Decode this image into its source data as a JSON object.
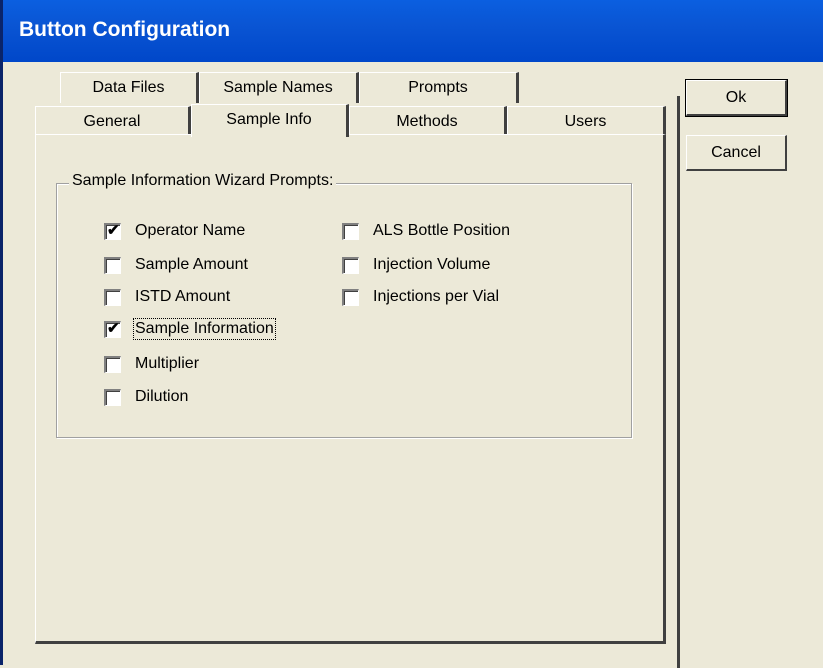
{
  "window": {
    "title": "Button Configuration"
  },
  "tabs_row_back": [
    {
      "label": "Data Files"
    },
    {
      "label": "Sample Names"
    },
    {
      "label": "Prompts"
    }
  ],
  "tabs_row_front": [
    {
      "label": "General"
    },
    {
      "label": "Sample Info"
    },
    {
      "label": "Methods"
    },
    {
      "label": "Users"
    }
  ],
  "group": {
    "label": "Sample Information Wizard Prompts:",
    "left_column": [
      {
        "label": "Operator Name",
        "checked": true
      },
      {
        "label": "Sample Amount",
        "checked": false
      },
      {
        "label": "ISTD Amount",
        "checked": false
      },
      {
        "label": "Sample Information",
        "checked": true
      },
      {
        "label": "Multiplier",
        "checked": false
      },
      {
        "label": "Dilution",
        "checked": false
      }
    ],
    "right_column": [
      {
        "label": "ALS Bottle Position",
        "checked": false
      },
      {
        "label": "Injection Volume",
        "checked": false
      },
      {
        "label": "Injections per Vial",
        "checked": false
      }
    ]
  },
  "buttons": {
    "ok": "Ok",
    "cancel": "Cancel"
  }
}
